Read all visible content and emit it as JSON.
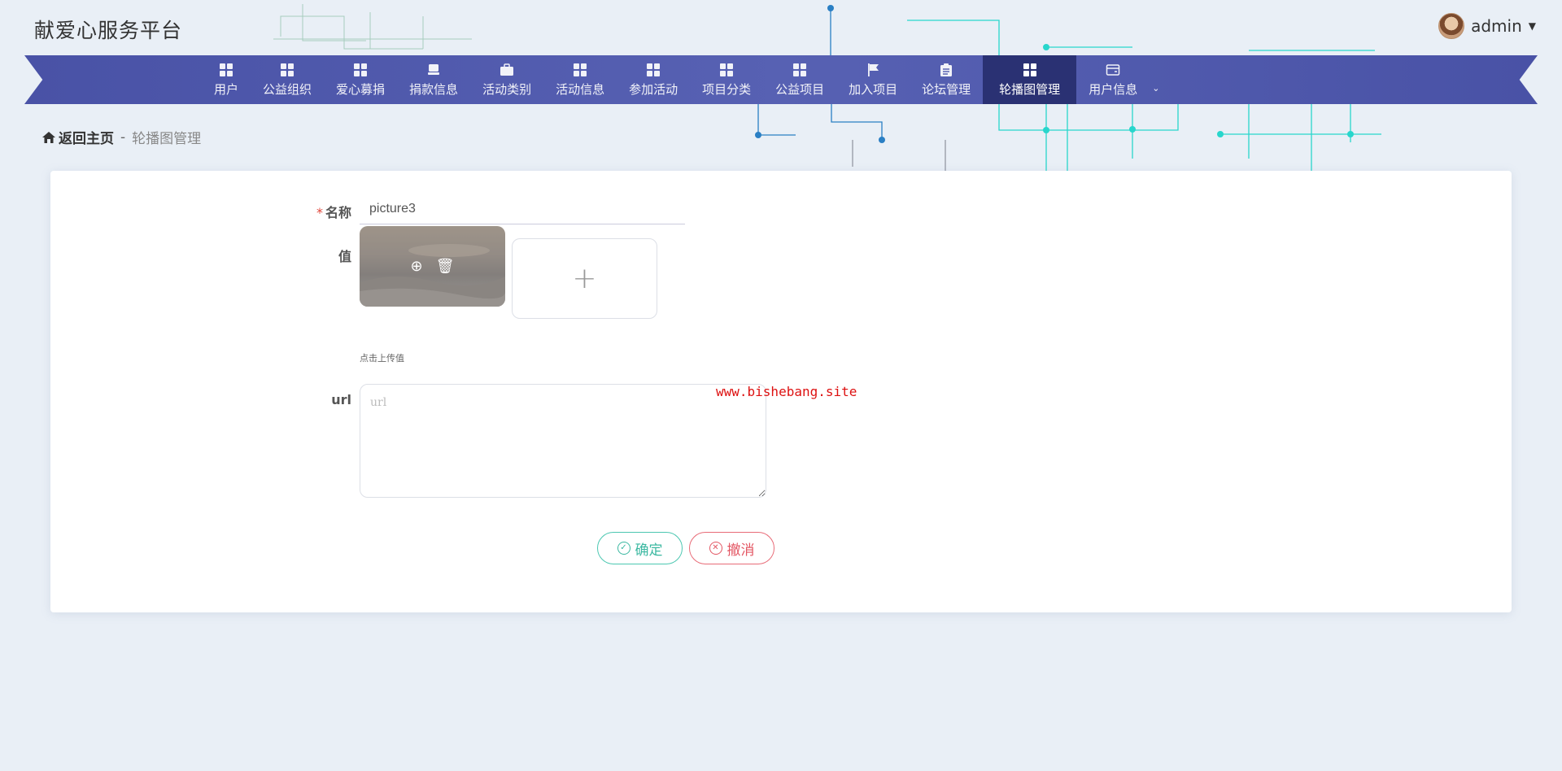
{
  "header": {
    "site_title": "献爱心服务平台",
    "user_name": "admin"
  },
  "nav": {
    "items": [
      {
        "label": "用户",
        "icon": "grid-icon"
      },
      {
        "label": "公益组织",
        "icon": "grid-icon"
      },
      {
        "label": "爱心募捐",
        "icon": "grid-icon"
      },
      {
        "label": "捐款信息",
        "icon": "stamp-icon"
      },
      {
        "label": "活动类别",
        "icon": "briefcase-icon"
      },
      {
        "label": "活动信息",
        "icon": "grid-icon"
      },
      {
        "label": "参加活动",
        "icon": "grid-icon"
      },
      {
        "label": "项目分类",
        "icon": "grid-icon"
      },
      {
        "label": "公益项目",
        "icon": "grid-icon"
      },
      {
        "label": "加入项目",
        "icon": "flag-icon"
      },
      {
        "label": "论坛管理",
        "icon": "clipboard-icon"
      },
      {
        "label": "轮播图管理",
        "icon": "grid-icon",
        "active": true
      },
      {
        "label": "用户信息",
        "icon": "wallet-icon"
      }
    ]
  },
  "breadcrumb": {
    "home": "返回主页",
    "separator": "-",
    "current": "轮播图管理"
  },
  "form": {
    "name_label": "名称",
    "required_mark": "*",
    "name_value": "picture3",
    "value_label": "值",
    "upload_plus": "+",
    "upload_tip": "点击上传值",
    "url_label": "url",
    "url_placeholder": "url",
    "confirm_label": "确定",
    "cancel_label": "撤消"
  },
  "watermark": "www.bishebang.site",
  "colors": {
    "nav_bg": "#5059ad",
    "nav_active": "#2a3173",
    "confirm": "#3bb8a1",
    "cancel": "#e35663",
    "watermark": "#dd1111"
  }
}
